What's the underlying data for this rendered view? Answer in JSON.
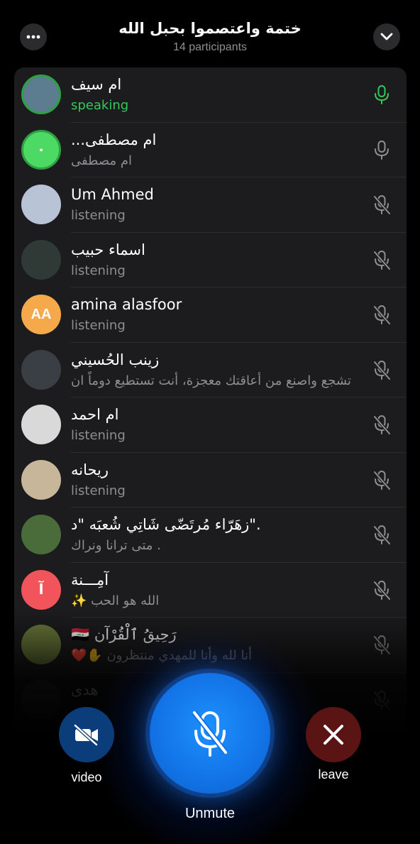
{
  "header": {
    "title": "ختمة واعتصموا بحبل الله",
    "subtitle": "14 participants",
    "more_icon": "ellipsis-icon",
    "collapse_icon": "chevron-down-icon"
  },
  "participants": [
    {
      "name": "ام سيف",
      "status": "speaking",
      "state": "speaking",
      "avatar_color": "#5c7d8f"
    },
    {
      "name": "...ام مصطفى",
      "status": "ام مصطفى",
      "state": "unmuted",
      "avatar_color": "#4cd964",
      "avatar_text": "٠"
    },
    {
      "name": "Um Ahmed",
      "status": "listening",
      "state": "muted",
      "avatar_color": "#b8c4d6"
    },
    {
      "name": "اسماء حبيب",
      "status": "listening",
      "state": "muted",
      "avatar_color": "#2f3a36"
    },
    {
      "name": "amina alasfoor",
      "status": "listening",
      "state": "muted",
      "avatar_color": "#f5a94a",
      "avatar_text": "AA"
    },
    {
      "name": "زينب الحُسيني",
      "status": "تشجع واصنع من أعاقتك معجزة، أنت تستطيع دوماً ان",
      "state": "muted",
      "avatar_color": "#3a3f45"
    },
    {
      "name": "ام احمد",
      "status": "listening",
      "state": "muted",
      "avatar_color": "#d9d9d9"
    },
    {
      "name": "ريحانه",
      "status": "listening",
      "state": "muted",
      "avatar_color": "#c8b69a"
    },
    {
      "name": "زهَرّاء مُرتَضّى شَاتِي شُعبَه \"د\".",
      "status": "متى ترانا ونراك .",
      "state": "muted",
      "avatar_color": "#4a6b3a"
    },
    {
      "name": "آمِـــنة",
      "status": "✨ الله هو الحب",
      "state": "muted",
      "avatar_color": "#f2545b",
      "avatar_text": "آ"
    },
    {
      "name": "🇮🇶 رَحِيقُ ٱلْقُرْآن",
      "status": "❤️✋ أنا لله وأنا للمهدي منتظرون",
      "state": "muted",
      "avatar_color": "#6b7a3a"
    },
    {
      "name": "هدى",
      "status": "",
      "state": "muted",
      "avatar_color": "#333"
    }
  ],
  "controls": {
    "video_label": "video",
    "unmute_label": "Unmute",
    "leave_label": "leave"
  },
  "colors": {
    "speaking": "#34c759",
    "accent": "#1e90ff",
    "leave": "#5a1414",
    "video": "#0a3d7a"
  }
}
